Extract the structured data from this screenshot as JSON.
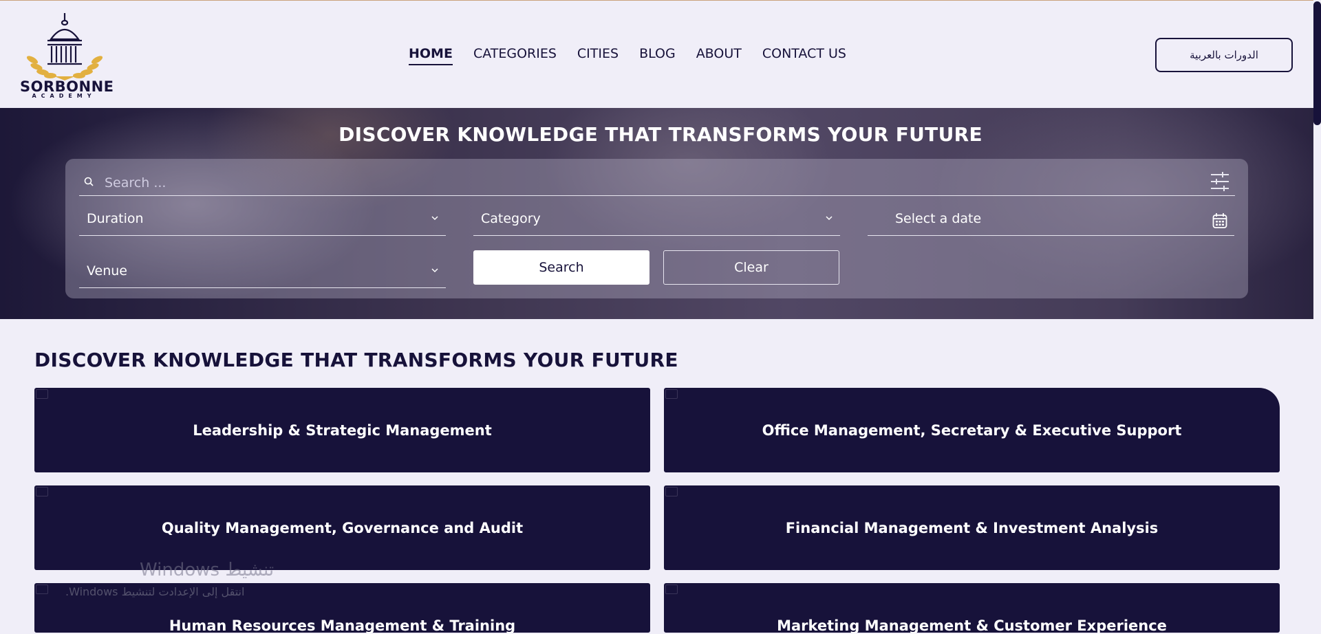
{
  "header": {
    "logo": {
      "name": "SORBONNE",
      "tagline": "ACADEMY"
    },
    "nav": [
      {
        "label": "HOME",
        "active": true
      },
      {
        "label": "CATEGORIES",
        "active": false
      },
      {
        "label": "CITIES",
        "active": false
      },
      {
        "label": "BLOG",
        "active": false
      },
      {
        "label": "ABOUT",
        "active": false
      },
      {
        "label": "CONTACT US",
        "active": false
      }
    ],
    "language_button": "الدورات بالعربية"
  },
  "hero": {
    "title": "DISCOVER KNOWLEDGE THAT TRANSFORMS YOUR FUTURE",
    "search": {
      "placeholder": "Search ...",
      "duration": "Duration",
      "category": "Category",
      "date": "Select a date",
      "venue": "Venue",
      "search_button": "Search",
      "clear_button": "Clear"
    }
  },
  "section": {
    "title": "DISCOVER KNOWLEDGE THAT TRANSFORMS YOUR FUTURE",
    "cards": [
      "Leadership & Strategic Management",
      "Office Management, Secretary & Executive Support",
      "Quality Management, Governance and Audit",
      "Financial Management & Investment Analysis",
      "Human Resources Management & Training",
      "Marketing Management & Customer Experience"
    ]
  },
  "watermark": {
    "title": "تنشيط Windows",
    "subtitle": "انتقل إلى الإعدادت لتنشيط Windows."
  },
  "colors": {
    "brand_navy": "#17123a",
    "page_bg": "#f0eef8",
    "logo_gold": "#e2b040"
  }
}
